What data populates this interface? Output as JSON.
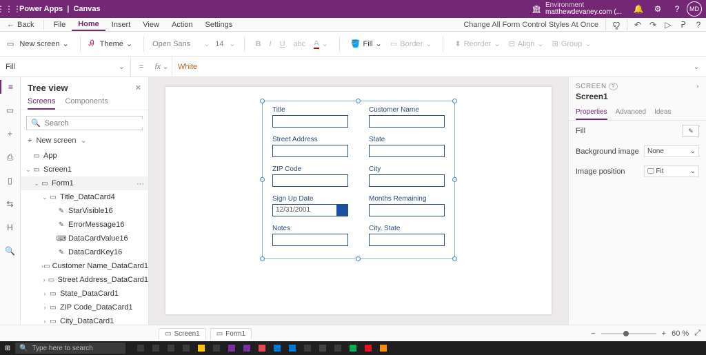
{
  "titlebar": {
    "app": "Power Apps",
    "section": "Canvas",
    "env_label": "Environment",
    "env_value": "matthewdevaney.com (...",
    "avatar": "MD"
  },
  "menu": {
    "back": "Back",
    "items": [
      "File",
      "Home",
      "Insert",
      "View",
      "Action",
      "Settings"
    ],
    "active_index": 1,
    "notice": "Change All Form Control Styles At Once"
  },
  "ribbon": {
    "newscreen": "New screen",
    "theme": "Theme",
    "font": "Open Sans",
    "size": "14",
    "fill": "Fill",
    "border": "Border",
    "reorder": "Reorder",
    "align": "Align",
    "group": "Group"
  },
  "formula": {
    "prop": "Fill",
    "fx": "fx",
    "value": "White"
  },
  "leftrail": [
    "≡",
    "▭",
    "+",
    "⎙",
    "▯",
    "⇆",
    "H",
    "🔍"
  ],
  "tree": {
    "title": "Tree view",
    "tabs": [
      "Screens",
      "Components"
    ],
    "active_tab": 0,
    "search_placeholder": "Search",
    "newscreen": "New screen",
    "nodes": [
      {
        "indent": 1,
        "chev": "",
        "icon": "▭",
        "label": "App"
      },
      {
        "indent": 1,
        "chev": "⌄",
        "icon": "▭",
        "label": "Screen1"
      },
      {
        "indent": 2,
        "chev": "⌄",
        "icon": "▭",
        "label": "Form1",
        "selected": true,
        "dots": true
      },
      {
        "indent": 3,
        "chev": "⌄",
        "icon": "▭",
        "label": "Title_DataCard4"
      },
      {
        "indent": 4,
        "chev": "",
        "icon": "✎",
        "label": "StarVisible16"
      },
      {
        "indent": 4,
        "chev": "",
        "icon": "✎",
        "label": "ErrorMessage16"
      },
      {
        "indent": 4,
        "chev": "",
        "icon": "⌨",
        "label": "DataCardValue16"
      },
      {
        "indent": 4,
        "chev": "",
        "icon": "✎",
        "label": "DataCardKey16"
      },
      {
        "indent": 3,
        "chev": "›",
        "icon": "▭",
        "label": "Customer Name_DataCard1"
      },
      {
        "indent": 3,
        "chev": "›",
        "icon": "▭",
        "label": "Street Address_DataCard1"
      },
      {
        "indent": 3,
        "chev": "›",
        "icon": "▭",
        "label": "State_DataCard1"
      },
      {
        "indent": 3,
        "chev": "›",
        "icon": "▭",
        "label": "ZIP Code_DataCard1"
      },
      {
        "indent": 3,
        "chev": "›",
        "icon": "▭",
        "label": "City_DataCard1"
      }
    ]
  },
  "form": {
    "fields": [
      {
        "label": "Title",
        "value": ""
      },
      {
        "label": "Customer Name",
        "value": ""
      },
      {
        "label": "Street Address",
        "value": ""
      },
      {
        "label": "State",
        "value": ""
      },
      {
        "label": "ZIP Code",
        "value": ""
      },
      {
        "label": "City",
        "value": ""
      },
      {
        "label": "Sign Up Date",
        "value": "12/31/2001",
        "date": true
      },
      {
        "label": "Months Remaining",
        "value": ""
      },
      {
        "label": "Notes",
        "value": ""
      },
      {
        "label": "City, State",
        "value": ""
      }
    ]
  },
  "rightpanel": {
    "header": "SCREEN",
    "title": "Screen1",
    "tabs": [
      "Properties",
      "Advanced",
      "Ideas"
    ],
    "active_tab": 0,
    "props": {
      "fill_label": "Fill",
      "bgimg_label": "Background image",
      "bgimg_value": "None",
      "imgpos_label": "Image position",
      "imgpos_value": "Fit"
    }
  },
  "tabstrip": {
    "tabs": [
      "Screen1",
      "Form1"
    ],
    "zoom": "60  %"
  },
  "taskbar": {
    "search": "Type here to search",
    "icons": [
      "#3a3a3a",
      "#3a3a3a",
      "#3a3a3a",
      "#3a3a3a",
      "#ffc107",
      "#3a3a3a",
      "#7b2fa0",
      "#7b2fa0",
      "#e74856",
      "#0078d7",
      "#0078d7",
      "#3a3a3a",
      "#444",
      "#3a3a3a",
      "#00b050",
      "#e81123",
      "#ff8c00"
    ]
  }
}
